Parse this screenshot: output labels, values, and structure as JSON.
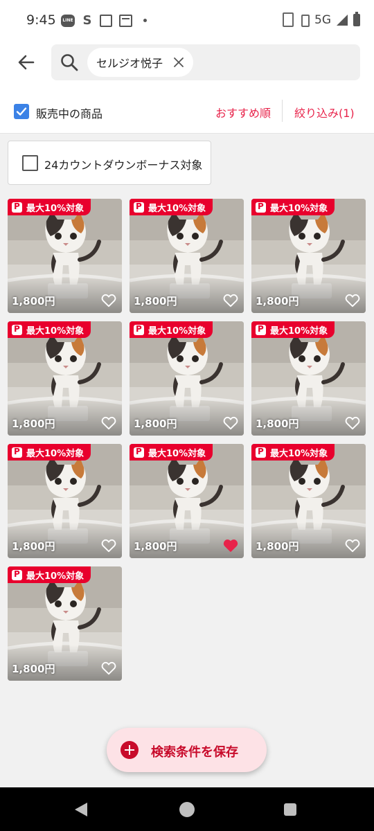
{
  "status_bar": {
    "time": "9:45",
    "left_icons": [
      "line-icon",
      "s-icon",
      "square-icon",
      "news-icon",
      "dot-icon"
    ],
    "line_label": "LINE",
    "s_label": "S",
    "network": "5G",
    "right_icons": [
      "nfc-icon",
      "vibrate-icon",
      "signal-icon",
      "battery-icon"
    ]
  },
  "header": {
    "back_icon": "arrow-left-icon",
    "search_icon": "search-icon",
    "query_chip": "セルジオ悦子",
    "chip_close_icon": "close-icon"
  },
  "filters": {
    "on_sale_label": "販売中の商品",
    "on_sale_checked": true,
    "sort_label": "おすすめ順",
    "filter_label": "絞り込み(1)",
    "bonus_label": "24カウントダウンボーナス対象",
    "bonus_checked": false
  },
  "items": [
    {
      "badge": "最大10%対象",
      "price": "1,800円",
      "liked": false
    },
    {
      "badge": "最大10%対象",
      "price": "1,800円",
      "liked": false
    },
    {
      "badge": "最大10%対象",
      "price": "1,800円",
      "liked": false
    },
    {
      "badge": "最大10%対象",
      "price": "1,800円",
      "liked": false
    },
    {
      "badge": "最大10%対象",
      "price": "1,800円",
      "liked": false
    },
    {
      "badge": "最大10%対象",
      "price": "1,800円",
      "liked": false
    },
    {
      "badge": "最大10%対象",
      "price": "1,800円",
      "liked": false
    },
    {
      "badge": "最大10%対象",
      "price": "1,800円",
      "liked": true
    },
    {
      "badge": "最大10%対象",
      "price": "1,800円",
      "liked": false
    },
    {
      "badge": "最大10%対象",
      "price": "1,800円",
      "liked": false
    }
  ],
  "save_button": {
    "label": "検索条件を保存",
    "icon": "plus-circle-icon"
  },
  "colors": {
    "accent_red": "#e8234a",
    "badge_red": "#e8002d",
    "checkbox_blue": "#3b82e6",
    "liked_heart": "#e8234a"
  },
  "nav_bar": [
    "back-triangle-icon",
    "home-circle-icon",
    "recents-square-icon"
  ]
}
